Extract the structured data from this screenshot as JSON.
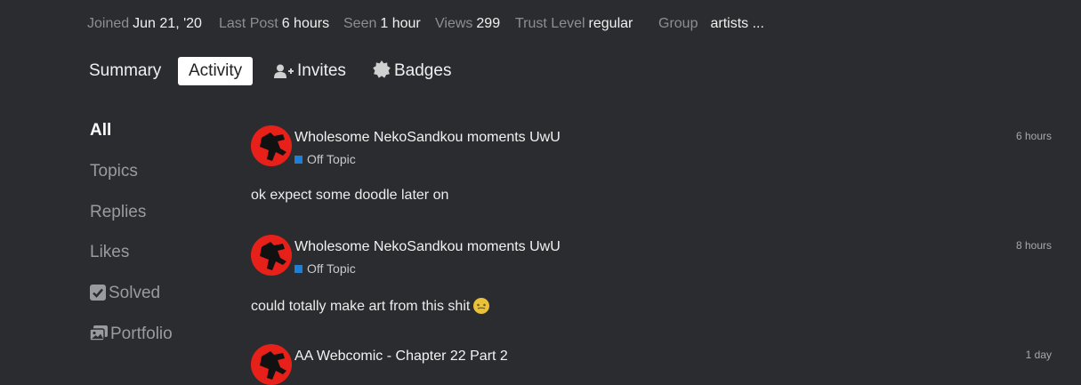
{
  "stats": [
    {
      "label": "Joined",
      "value": "Jun 21, '20"
    },
    {
      "label": "Last Post",
      "value": "6 hours"
    },
    {
      "label": "Seen",
      "value": "1 hour"
    },
    {
      "label": "Views",
      "value": "299"
    },
    {
      "label": "Trust Level",
      "value": "regular"
    },
    {
      "label": "Group",
      "value": "artists ..."
    }
  ],
  "tabs": [
    {
      "label": "Summary",
      "icon": ""
    },
    {
      "label": "Activity",
      "icon": ""
    },
    {
      "label": "Invites",
      "icon": "user-plus-icon"
    },
    {
      "label": "Badges",
      "icon": "certificate-icon"
    }
  ],
  "filters": [
    {
      "label": "All",
      "icon": ""
    },
    {
      "label": "Topics",
      "icon": ""
    },
    {
      "label": "Replies",
      "icon": ""
    },
    {
      "label": "Likes",
      "icon": ""
    },
    {
      "label": "Solved",
      "icon": "check-square-icon"
    },
    {
      "label": "Portfolio",
      "icon": "images-icon"
    }
  ],
  "posts": [
    {
      "title": "Wholesome NekoSandkou moments UwU",
      "category": "Off Topic",
      "time": "6 hours",
      "excerpt": "ok expect some doodle later on"
    },
    {
      "title": "Wholesome NekoSandkou moments UwU",
      "category": "Off Topic",
      "time": "8 hours",
      "excerpt": "could totally make art from this shit"
    },
    {
      "title": "AA Webcomic - Chapter 22 Part 2",
      "category": "",
      "time": "1 day",
      "excerpt": ""
    }
  ],
  "colors": {
    "background": "#2b2c30",
    "category": "#1e7fd6",
    "avatar": "#e8201a"
  }
}
